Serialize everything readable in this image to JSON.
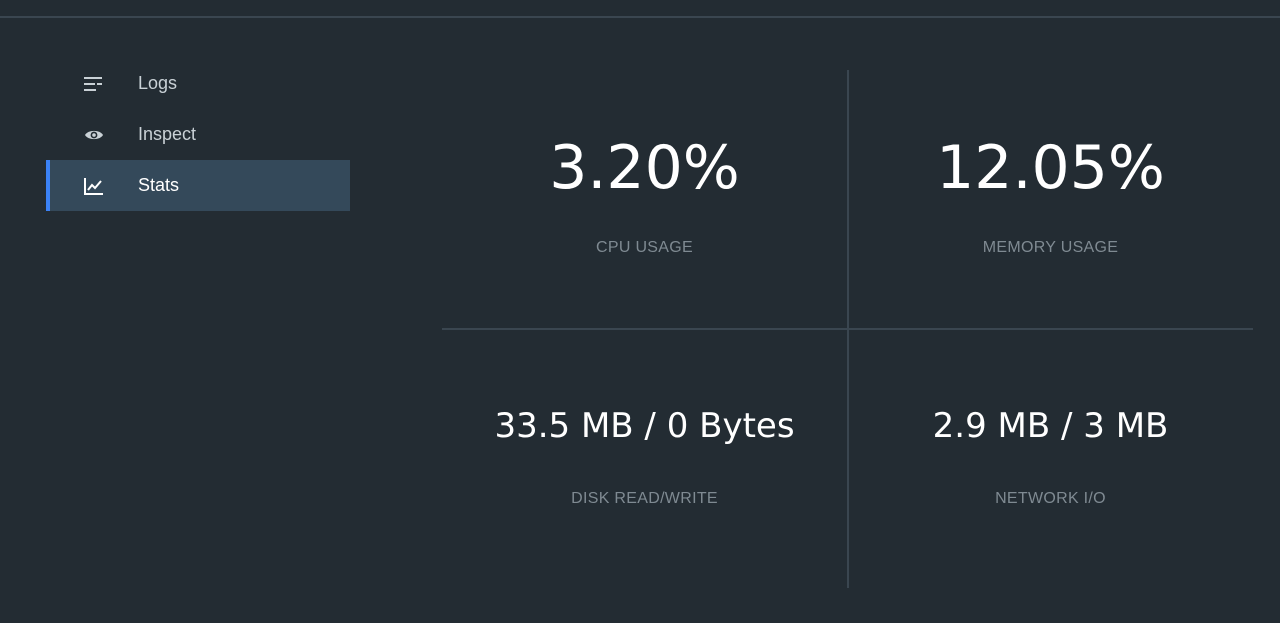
{
  "sidebar": {
    "items": [
      {
        "label": "Logs",
        "icon": "logs-icon",
        "active": false
      },
      {
        "label": "Inspect",
        "icon": "eye-icon",
        "active": false
      },
      {
        "label": "Stats",
        "icon": "chart-icon",
        "active": true
      }
    ],
    "accent_color": "#3b82f6"
  },
  "stats": {
    "cpu": {
      "value": "3.20%",
      "caption": "CPU USAGE"
    },
    "memory": {
      "value": "12.05%",
      "caption": "MEMORY USAGE"
    },
    "disk": {
      "value": "33.5 MB / 0 Bytes",
      "caption": "DISK READ/WRITE"
    },
    "network": {
      "value": "2.9 MB / 3 MB",
      "caption": "NETWORK I/O"
    }
  }
}
